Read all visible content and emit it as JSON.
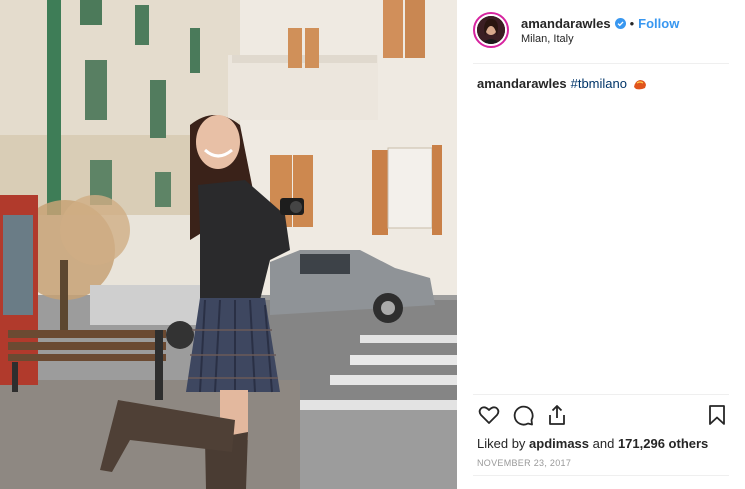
{
  "post": {
    "username": "amandarawles",
    "location": "Milan, Italy",
    "follow_label": "Follow",
    "dot": "•",
    "caption": {
      "username": "amandarawles",
      "hashtag": "#tbmilano"
    },
    "likes": {
      "prefix": "Liked by ",
      "liker": "apdimass",
      "middle": " and ",
      "count": "171,296 others"
    },
    "date": "NOVEMBER 23, 2017"
  },
  "icons": {
    "like": "heart-icon",
    "comment": "comment-bubble-icon",
    "share": "share-icon",
    "save": "bookmark-icon",
    "verified": "verified-badge-icon",
    "emoji": "emoji-icon"
  },
  "colors": {
    "link": "#3897f0",
    "verified": "#3897f0",
    "text": "#262626",
    "muted": "#999999"
  }
}
